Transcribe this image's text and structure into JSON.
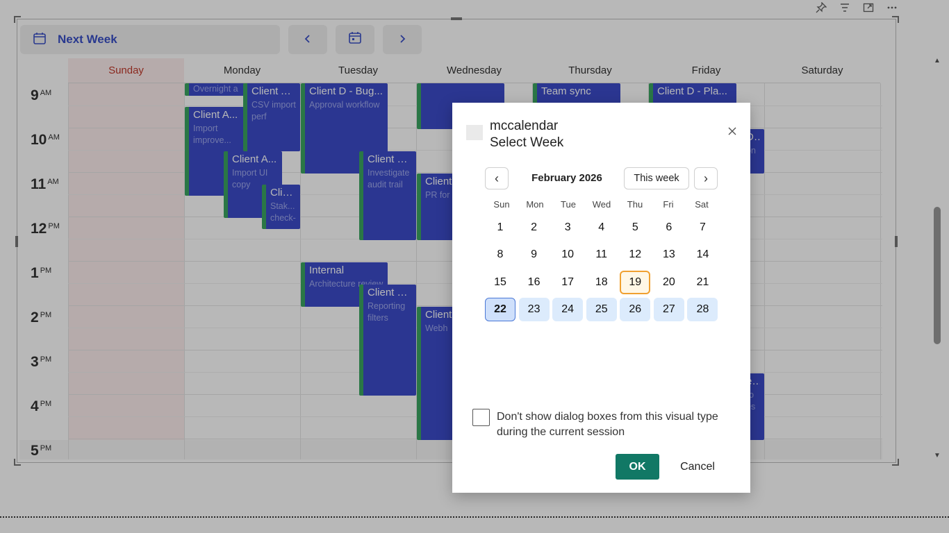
{
  "toolbar": {
    "title": "Next Week",
    "prev_icon": "chevron-left-icon",
    "today_icon": "calendar-icon",
    "next_icon": "chevron-right-icon"
  },
  "top_icons": [
    "pin-icon",
    "filter-icon",
    "focus-mode-icon",
    "more-options-icon"
  ],
  "calendar": {
    "days": [
      "Sunday",
      "Monday",
      "Tuesday",
      "Wednesday",
      "Thursday",
      "Friday",
      "Saturday"
    ],
    "hours": [
      {
        "h": "9",
        "ap": "AM"
      },
      {
        "h": "10",
        "ap": "AM"
      },
      {
        "h": "11",
        "ap": "AM"
      },
      {
        "h": "12",
        "ap": "PM"
      },
      {
        "h": "1",
        "ap": "PM"
      },
      {
        "h": "2",
        "ap": "PM"
      },
      {
        "h": "3",
        "ap": "PM"
      },
      {
        "h": "4",
        "ap": "PM"
      },
      {
        "h": "5",
        "ap": "PM"
      }
    ],
    "events": [
      {
        "title": "",
        "desc": "Overnight a"
      },
      {
        "title": "Client A...",
        "desc": "CSV import perf"
      },
      {
        "title": "Client A...",
        "desc": "Import improve..."
      },
      {
        "title": "Client A...",
        "desc": "Import UI copy"
      },
      {
        "title": "Clie...",
        "desc": "Stak... check-"
      },
      {
        "title": "Client D - Bug...",
        "desc": "Approval workflow"
      },
      {
        "title": "Client D...",
        "desc": "Investigate audit trail"
      },
      {
        "title": "Internal",
        "desc": "Architecture review"
      },
      {
        "title": "Client B...",
        "desc": "Reporting filters"
      },
      {
        "title": "",
        "desc": ""
      },
      {
        "title": "Client",
        "desc": "PR for change"
      },
      {
        "title": "Client",
        "desc": "Webh"
      },
      {
        "title": "Team sync",
        "desc": ""
      },
      {
        "title": "Client D - Pla...",
        "desc": ""
      },
      {
        "title": "D...",
        "desc": "on"
      },
      {
        "title": "e...",
        "desc": "ro es"
      }
    ]
  },
  "dialog": {
    "app_name": "mccalendar",
    "title": "Select Week",
    "close_icon": "close-icon",
    "month_label": "February 2026",
    "prev_label": "‹",
    "next_label": "›",
    "this_week_label": "This week",
    "weekdays": [
      "Sun",
      "Mon",
      "Tue",
      "Wed",
      "Thu",
      "Fri",
      "Sat"
    ],
    "weeks": [
      [
        "1",
        "2",
        "3",
        "4",
        "5",
        "6",
        "7"
      ],
      [
        "8",
        "9",
        "10",
        "11",
        "12",
        "13",
        "14"
      ],
      [
        "15",
        "16",
        "17",
        "18",
        "19",
        "20",
        "21"
      ],
      [
        "22",
        "23",
        "24",
        "25",
        "26",
        "27",
        "28"
      ]
    ],
    "today": "19",
    "selected_week": [
      "22",
      "28"
    ],
    "checkbox_label": "Don't show dialog boxes from this visual type during the current session",
    "checkbox_checked": false,
    "ok_label": "OK",
    "cancel_label": "Cancel"
  },
  "colors": {
    "accent": "#3a4fc6",
    "event_bg": "#3c4cc9",
    "event_stripe": "#3ba561",
    "sunday_text": "#c0392b",
    "ok_button": "#117865",
    "today_border": "#f0a030",
    "selected_week_bg": "#dcebfc"
  }
}
